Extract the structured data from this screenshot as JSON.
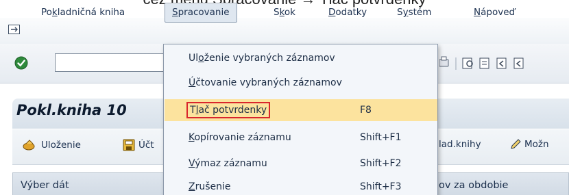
{
  "caption": "cez menu Spracovanie → Tlač potvrdenky",
  "menubar": {
    "items": [
      {
        "pre": "Po",
        "key": "k",
        "post": "ladničná kniha"
      },
      {
        "pre": "",
        "key": "S",
        "post": "pracovanie"
      },
      {
        "pre": "S",
        "key": "k",
        "post": "ok"
      },
      {
        "pre": "",
        "key": "D",
        "post": "odatky"
      },
      {
        "pre": "S",
        "key": "y",
        "post": "stém"
      },
      {
        "pre": "",
        "key": "N",
        "post": "ápoveď"
      }
    ]
  },
  "dropdown": {
    "items": [
      {
        "pre": "Ul",
        "key": "o",
        "post": "ženie vybraných záznamov",
        "shortcut": ""
      },
      {
        "pre": "",
        "key": "Ú",
        "post": "čtovanie vybraných záznamov",
        "shortcut": ""
      },
      {
        "pre": "T",
        "key": "l",
        "post": "ač potvrdenky",
        "shortcut": "F8"
      },
      {
        "pre": "",
        "key": "K",
        "post": "opírovanie záznamu",
        "shortcut": "Shift+F1"
      },
      {
        "pre": "",
        "key": "V",
        "post": "ýmaz záznamu",
        "shortcut": "Shift+F2"
      },
      {
        "pre": "",
        "key": "Z",
        "post": "rušenie",
        "shortcut": "Shift+F3"
      }
    ]
  },
  "page_title": "Pokl.kniha 10",
  "app_toolbar": {
    "save": "Uloženie",
    "post": "Účt",
    "journal": "lad.knihy",
    "options": "Možn"
  },
  "section": {
    "left": "Výber dát",
    "right": "ov za obdobie"
  },
  "colors": {
    "highlight": "#fce39e",
    "callout_border": "#d9262c",
    "text": "#1c3150"
  }
}
